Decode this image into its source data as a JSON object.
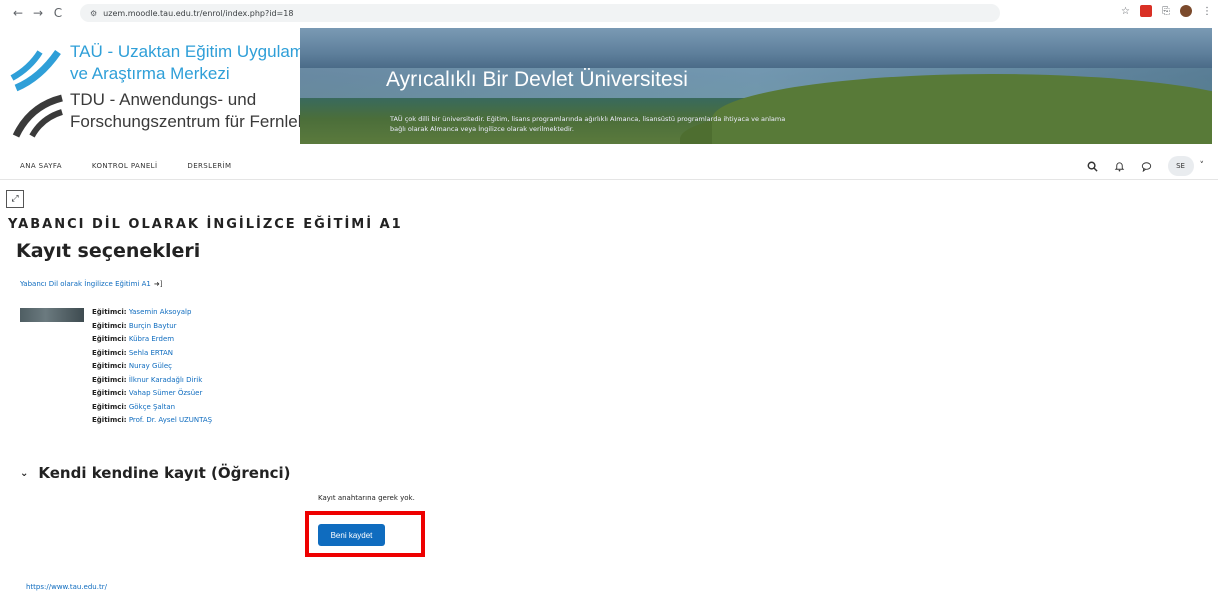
{
  "browser": {
    "url": "uzem.moodle.tau.edu.tr/enrol/index.php?id=18",
    "back_icon": "←",
    "forward_icon": "→",
    "reload_icon": "C",
    "site_info_icon": "⚙",
    "star_icon": "☆",
    "extensions_icon": "⎘",
    "menu_icon": "⋮"
  },
  "banner": {
    "logo_line1": "TAÜ - Uzaktan Eğitim Uygulama",
    "logo_line2": "ve Araştırma Merkezi",
    "logo_line3": "TDU - Anwendungs- und",
    "logo_line4": "Forschungszentrum für Fernlehre",
    "hero_title": "Ayrıcalıklı Bir Devlet Üniversitesi",
    "hero_description": "TAÜ çok dilli bir üniversitedir. Eğitim, lisans programlarında ağırlıklı Almanca, lisansüstü programlarda ihtiyaca ve anlama bağlı olarak Almanca veya İngilizce olarak verilmektedir."
  },
  "nav": {
    "items": [
      "ANA SAYFA",
      "KONTROL PANELİ",
      "DERSLERİM"
    ],
    "user_initials": "SE",
    "chevron": "˅"
  },
  "content": {
    "expand_icon": "⤢",
    "course_title": "YABANCI DİL OLARAK İNGİLİZCE EĞİTİMİ A1",
    "page_heading": "Kayıt seçenekleri",
    "course_link": "Yabancı Dil olarak İngilizce Eğitimi A1",
    "teachers": [
      {
        "role": "Eğitimci:",
        "name": "Yasemin Aksoyalp"
      },
      {
        "role": "Eğitimci:",
        "name": "Burçin Baytur"
      },
      {
        "role": "Eğitimci:",
        "name": "Kübra Erdem"
      },
      {
        "role": "Eğitimci:",
        "name": "Sehla ERTAN"
      },
      {
        "role": "Eğitimci:",
        "name": "Nuray Güleç"
      },
      {
        "role": "Eğitimci:",
        "name": "İlknur Karadağlı Dirik"
      },
      {
        "role": "Eğitimci:",
        "name": "Vahap Sümer Özsüer"
      },
      {
        "role": "Eğitimci:",
        "name": "Gökçe Şaltan"
      },
      {
        "role": "Eğitimci:",
        "name": "Prof. Dr. Aysel UZUNTAŞ"
      }
    ],
    "section_title": "Kendi kendine kayıt (Öğrenci)",
    "no_key_text": "Kayıt anahtarına gerek yok.",
    "enrol_button": "Beni kaydet",
    "footer_link": "https://www.tau.edu.tr/"
  },
  "colors": {
    "link": "#0f6cbf",
    "primary_button": "#0f6cbf",
    "highlight": "#ee0000"
  }
}
